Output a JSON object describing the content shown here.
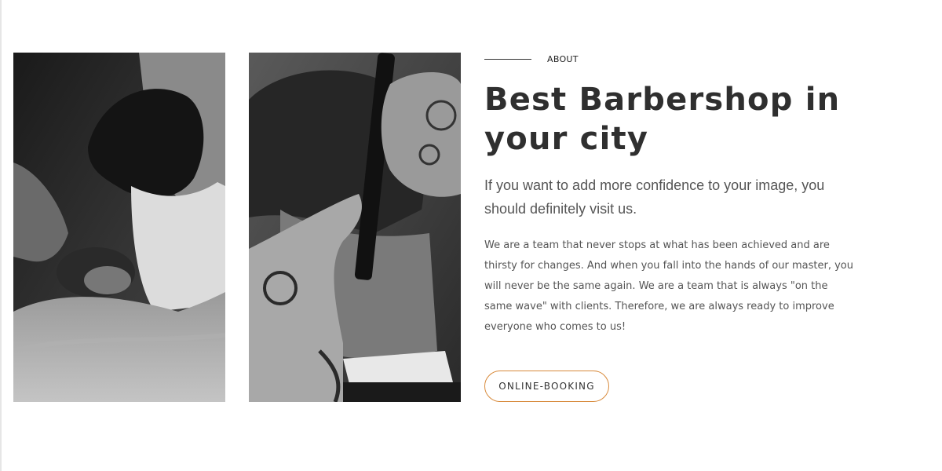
{
  "about": {
    "label": "ABOUT"
  },
  "hero": {
    "title": "Best Barbershop in your city",
    "lead": "If you want to add more confidence to your image, you should definitely visit us.",
    "body": "We are a team that never stops at what has been achieved and are thirsty for changes. And when you fall into the hands of our master, you will never be the same again. We are a team that is always \"on the same wave\" with clients. Therefore, we are always ready to improve everyone who comes to us!"
  },
  "booking_button": {
    "label": "ONLINE-BOOKING"
  },
  "colors": {
    "accent": "#d88a3b",
    "heading": "#2f2f2f",
    "text": "#555555"
  },
  "images": [
    {
      "name": "beard-shave-photo"
    },
    {
      "name": "haircut-photo"
    }
  ]
}
